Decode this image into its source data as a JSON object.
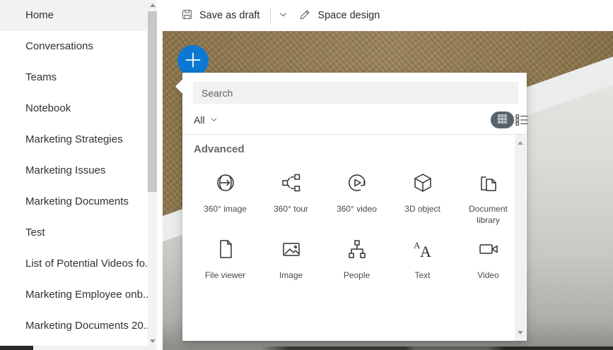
{
  "sidebar": {
    "items": [
      {
        "label": "Home"
      },
      {
        "label": "Conversations"
      },
      {
        "label": "Teams"
      },
      {
        "label": "Notebook"
      },
      {
        "label": "Marketing Strategies"
      },
      {
        "label": "Marketing Issues"
      },
      {
        "label": "Marketing Documents"
      },
      {
        "label": "Test"
      },
      {
        "label": "List of Potential Videos fo..."
      },
      {
        "label": "Marketing Employee onb..."
      },
      {
        "label": "Marketing Documents 20..."
      }
    ]
  },
  "toolbar": {
    "save_label": "Save as draft",
    "design_label": "Space design"
  },
  "panel": {
    "search_placeholder": "Search",
    "filter_label": "All",
    "section_title": "Advanced",
    "view_toggle": {
      "selected": "grid"
    },
    "tiles": [
      {
        "label": "360° image",
        "icon": "globe-360-icon"
      },
      {
        "label": "360° tour",
        "icon": "tour-360-icon"
      },
      {
        "label": "360° video",
        "icon": "video-360-icon"
      },
      {
        "label": "3D object",
        "icon": "cube-3d-icon"
      },
      {
        "label": "Document library",
        "icon": "document-library-icon"
      },
      {
        "label": "File viewer",
        "icon": "file-viewer-icon"
      },
      {
        "label": "Image",
        "icon": "image-icon"
      },
      {
        "label": "People",
        "icon": "people-icon"
      },
      {
        "label": "Text",
        "icon": "text-icon"
      },
      {
        "label": "Video",
        "icon": "video-icon"
      }
    ]
  },
  "colors": {
    "accent_blue": "#0b79d4",
    "toggle_pill": "#57626d",
    "search_bg": "#f3f2f1",
    "text_dark": "#323130",
    "text_muted": "#696969"
  }
}
